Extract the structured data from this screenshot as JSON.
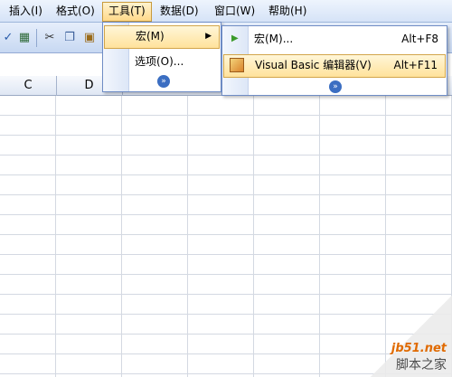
{
  "menubar": {
    "items": [
      "插入(I)",
      "格式(O)",
      "工具(T)",
      "数据(D)",
      "窗口(W)",
      "帮助(H)"
    ],
    "active_index": 2
  },
  "toolbar": {
    "icons": [
      "spell-check-icon",
      "research-icon",
      "cut-icon",
      "copy-icon",
      "paste-icon"
    ]
  },
  "columns": [
    "C",
    "D"
  ],
  "tools_menu": {
    "items": [
      {
        "label": "宏(M)",
        "has_submenu": true,
        "highlighted": true
      },
      {
        "label": "选项(O)...",
        "has_submenu": false,
        "highlighted": false
      }
    ],
    "expand_icon": "chevron-double-down-icon"
  },
  "macro_submenu": {
    "items": [
      {
        "label": "宏(M)...",
        "shortcut": "Alt+F8",
        "icon": "play-icon",
        "highlighted": false
      },
      {
        "label": "Visual Basic 编辑器(V)",
        "shortcut": "Alt+F11",
        "icon": "vb-editor-icon",
        "highlighted": true
      }
    ],
    "expand_icon": "chevron-double-down-icon"
  },
  "watermark": {
    "url": "jb51.net",
    "name": "脚本之家"
  },
  "colors": {
    "menu_border": "#6e8cc5",
    "highlight": "#ffe29b",
    "menubar": "#d6e3f7"
  }
}
